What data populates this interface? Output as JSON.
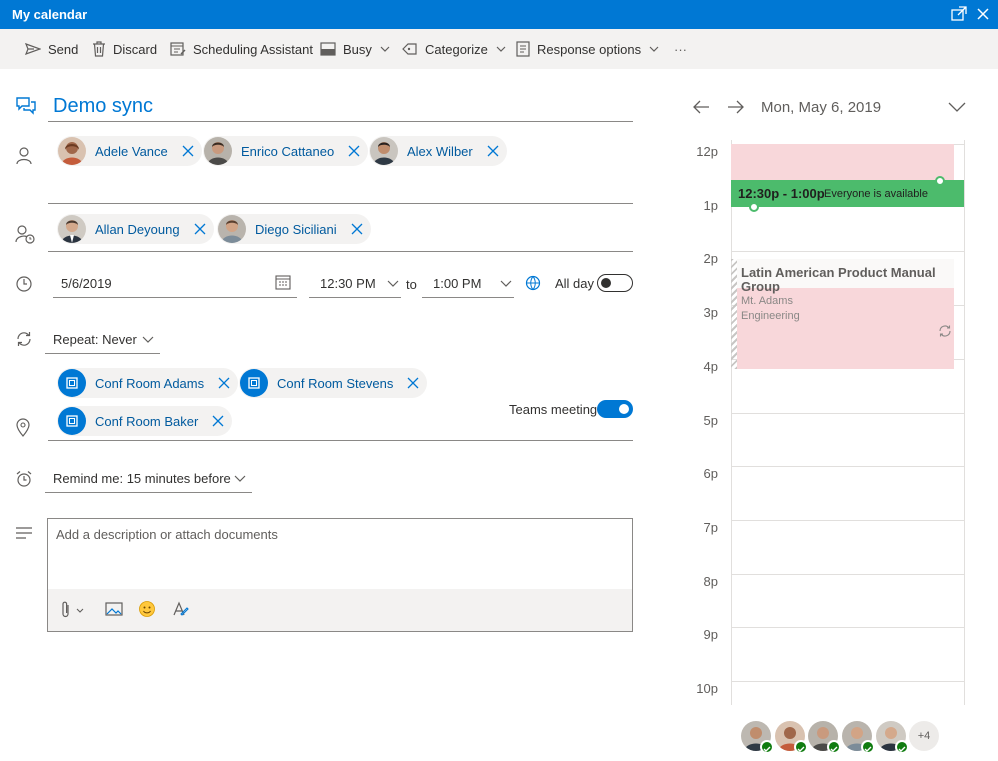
{
  "window": {
    "title": "My calendar"
  },
  "toolbar": {
    "send": "Send",
    "discard": "Discard",
    "scheduling": "Scheduling Assistant",
    "busy": "Busy",
    "categorize": "Categorize",
    "response": "Response options",
    "more": "···"
  },
  "event": {
    "title": "Demo sync"
  },
  "required_attendees": [
    {
      "name": "Adele Vance"
    },
    {
      "name": "Enrico Cattaneo"
    },
    {
      "name": "Alex Wilber"
    }
  ],
  "optional_attendees": [
    {
      "name": "Allan Deyoung"
    },
    {
      "name": "Diego Siciliani"
    }
  ],
  "datetime": {
    "date": "5/6/2019",
    "start": "12:30 PM",
    "to": "to",
    "end": "1:00 PM",
    "allday_label": "All day"
  },
  "repeat": {
    "label": "Repeat:",
    "value": "Never"
  },
  "rooms": [
    {
      "name": "Conf Room Adams"
    },
    {
      "name": "Conf Room Stevens"
    },
    {
      "name": "Conf Room Baker"
    }
  ],
  "teams": {
    "label": "Teams meeting",
    "enabled": true
  },
  "reminder": {
    "label": "Remind me:",
    "value": "15 minutes before"
  },
  "description": {
    "placeholder": "Add a description or attach documents"
  },
  "calendar": {
    "date": "Mon, May 6, 2019",
    "hours": [
      "12p",
      "1p",
      "2p",
      "3p",
      "4p",
      "5p",
      "6p",
      "7p",
      "8p",
      "9p",
      "10p"
    ],
    "slot": {
      "time": "12:30p - 1:00p",
      "status": "Everyone is available"
    },
    "event": {
      "title": "Latin American Product Manual Group",
      "location": "Mt. Adams",
      "category": "Engineering"
    }
  },
  "attendee_summary": {
    "more": "+4"
  },
  "colors": {
    "accent": "#0078d4",
    "busy": "#f8d7da",
    "available": "#4cbb6c",
    "accepted": "#107c10"
  }
}
